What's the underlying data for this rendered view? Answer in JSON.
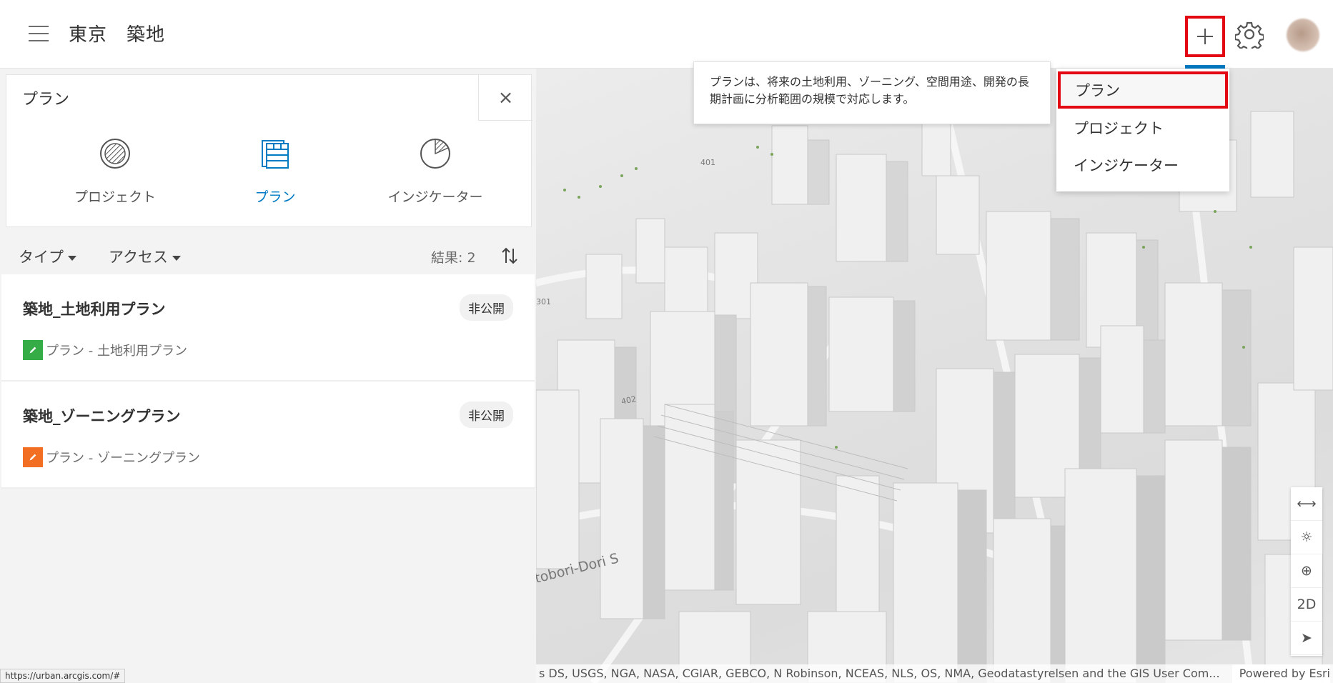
{
  "header": {
    "title": "東京　築地",
    "add_button": "+",
    "settings_icon": "gear-icon",
    "avatar": "user-avatar"
  },
  "search": {
    "value": "プラン",
    "close_label": "×"
  },
  "type_tabs": [
    {
      "label": "プロジェクト",
      "icon": "project-icon",
      "active": false
    },
    {
      "label": "プラン",
      "icon": "plan-icon",
      "active": true
    },
    {
      "label": "インジケーター",
      "icon": "indicator-icon",
      "active": false
    }
  ],
  "filters": {
    "type_label": "タイプ",
    "access_label": "アクセス",
    "results_label": "結果: 2"
  },
  "items": [
    {
      "title": "築地_土地利用プラン",
      "badge": "非公開",
      "subtitle": "プラン - 土地利用プラン",
      "color": "#35ac46"
    },
    {
      "title": "築地_ゾーニングプラン",
      "badge": "非公開",
      "subtitle": "プラン - ゾーニングプラン",
      "color": "#f26e22"
    }
  ],
  "tooltip": {
    "text": "プランは、将来の土地利用、ゾーニング、空間用途、開発の長期計画に分析範囲の規模で対応します。"
  },
  "dropdown": {
    "items": [
      "プラン",
      "プロジェクト",
      "インジケーター"
    ]
  },
  "map": {
    "labels": [
      "401",
      "301",
      "402",
      "tobori-Dori S"
    ],
    "tools": [
      "measure-icon",
      "daylight-icon",
      "zoom-area-icon",
      "2D",
      "navigate-icon"
    ],
    "attribution": "s DS, USGS, NGA, NASA, CGIAR, GEBCO, N Robinson, NCEAS, NLS, OS, NMA, Geodatastyrelsen and the GIS User Com...",
    "powered_by": "Powered by Esri"
  },
  "status_url": "https://urban.arcgis.com/#",
  "colors": {
    "accent": "#007ac2",
    "highlight_red": "#e30613",
    "land_use_green": "#35ac46",
    "zoning_orange": "#f26e22"
  }
}
